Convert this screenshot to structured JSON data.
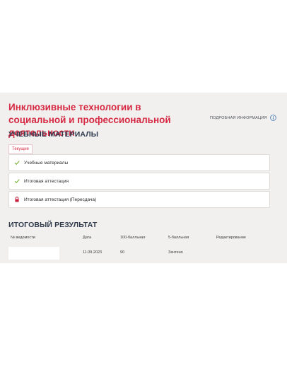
{
  "course": {
    "title": "Инклюзивные технологии в социальной и профессиональной деятельности"
  },
  "details_link": {
    "label": "ПОДРОБНАЯ ИНФОРМАЦИЯ",
    "icon": "info-icon"
  },
  "materials": {
    "heading": "УЧЕБНЫЕ МАТЕРИАЛЫ",
    "tab_label": "Текущие",
    "items": [
      {
        "label": "Учебные материалы",
        "icon": "check-icon",
        "state": "available"
      },
      {
        "label": "Итоговая аттестация",
        "icon": "check-icon",
        "state": "available"
      },
      {
        "label": "Итоговая аттестация (Пересдача)",
        "icon": "lock-icon",
        "state": "locked"
      }
    ]
  },
  "results": {
    "heading": "ИТОГОВЫЙ РЕЗУЛЬТАТ",
    "columns": [
      "№ ведомости",
      "Дата",
      "100-балльная",
      "5-балльная",
      "Редактирование"
    ],
    "rows": [
      {
        "sheet_no": "",
        "date": "11.09.2023",
        "score_100": "90",
        "score_5": "Зачтено",
        "edit": ""
      }
    ]
  },
  "colors": {
    "accent": "#d62a44",
    "heading": "#2f3b4c",
    "check": "#7bb33a",
    "lock": "#c8233f",
    "panel_bg": "#f1f0ee"
  }
}
